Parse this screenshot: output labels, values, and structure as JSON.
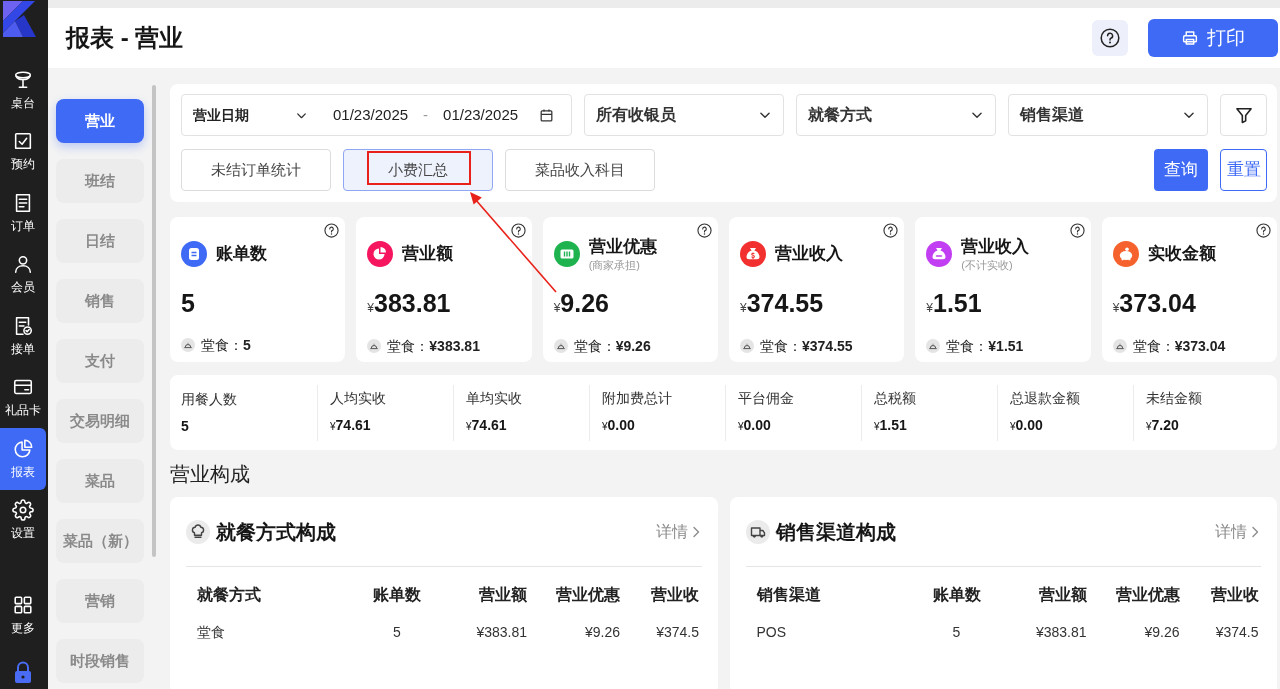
{
  "app_nav": [
    {
      "label": "桌台",
      "selected": false
    },
    {
      "label": "预约",
      "selected": false
    },
    {
      "label": "订单",
      "selected": false
    },
    {
      "label": "会员",
      "selected": false
    },
    {
      "label": "接单",
      "selected": false
    },
    {
      "label": "礼品卡",
      "selected": false
    },
    {
      "label": "报表",
      "selected": true
    },
    {
      "label": "设置",
      "selected": false
    },
    {
      "label": "更多",
      "selected": false
    }
  ],
  "header": {
    "title": "报表 - 营业",
    "print_button": "打印"
  },
  "report_nav": [
    {
      "label": "营业",
      "selected": true
    },
    {
      "label": "班结",
      "selected": false
    },
    {
      "label": "日结",
      "selected": false
    },
    {
      "label": "销售",
      "selected": false
    },
    {
      "label": "支付",
      "selected": false
    },
    {
      "label": "交易明细",
      "selected": false
    },
    {
      "label": "菜品",
      "selected": false
    },
    {
      "label": "菜品（新）",
      "selected": false
    },
    {
      "label": "营销",
      "selected": false
    },
    {
      "label": "时段销售",
      "selected": false
    }
  ],
  "filters": {
    "date_range": {
      "label": "营业日期",
      "start": "01/23/2025",
      "separator": "-",
      "end": "01/23/2025"
    },
    "selects": [
      {
        "value": "所有收银员"
      },
      {
        "value": "就餐方式"
      },
      {
        "value": "销售渠道"
      }
    ],
    "quick_filters": [
      {
        "label": "未结订单统计",
        "selected": false,
        "highlighted": false
      },
      {
        "label": "小费汇总",
        "selected": true,
        "highlighted": true
      },
      {
        "label": "菜品收入科目",
        "selected": false,
        "highlighted": false
      }
    ],
    "query_button": "查询",
    "reset_button": "重置"
  },
  "summary_cards": [
    {
      "title": "账单数",
      "value": "5",
      "detail_label": "堂食：",
      "detail_value": "5",
      "color": "#3e6af5"
    },
    {
      "title": "营业额",
      "currency": "¥",
      "value": "383.81",
      "detail_label": "堂食：",
      "detail_value": "¥383.81",
      "color": "#f5165f"
    },
    {
      "title": "营业优惠",
      "subtitle": "(商家承担)",
      "currency": "¥",
      "value": "9.26",
      "detail_label": "堂食：",
      "detail_value": "¥9.26",
      "color": "#1fb34f"
    },
    {
      "title": "营业收入",
      "currency": "¥",
      "value": "374.55",
      "detail_label": "堂食：",
      "detail_value": "¥374.55",
      "color": "#f23030"
    },
    {
      "title": "营业收入",
      "subtitle": "(不计实收)",
      "currency": "¥",
      "value": "1.51",
      "detail_label": "堂食：",
      "detail_value": "¥1.51",
      "color": "#c23ef2"
    },
    {
      "title": "实收金额",
      "currency": "¥",
      "value": "373.04",
      "detail_label": "堂食：",
      "detail_value": "¥373.04",
      "color": "#f5622d"
    }
  ],
  "stats": [
    {
      "label": "用餐人数",
      "value": "5"
    },
    {
      "label": "人均实收",
      "currency": "¥",
      "value": "74.61"
    },
    {
      "label": "单均实收",
      "currency": "¥",
      "value": "74.61"
    },
    {
      "label": "附加费总计",
      "currency": "¥",
      "value": "0.00"
    },
    {
      "label": "平台佣金",
      "currency": "¥",
      "value": "0.00"
    },
    {
      "label": "总税额",
      "currency": "¥",
      "value": "1.51"
    },
    {
      "label": "总退款金额",
      "currency": "¥",
      "value": "0.00"
    },
    {
      "label": "未结金额",
      "currency": "¥",
      "value": "7.20"
    }
  ],
  "section_title": "营业构成",
  "breakdowns": [
    {
      "title": "就餐方式构成",
      "details_link": "详情",
      "columns": [
        "就餐方式",
        "账单数",
        "营业额",
        "营业优惠",
        "营业收"
      ],
      "rows": [
        [
          "堂食",
          "5",
          "¥383.81",
          "¥9.26",
          "¥374.5"
        ]
      ]
    },
    {
      "title": "销售渠道构成",
      "details_link": "详情",
      "columns": [
        "销售渠道",
        "账单数",
        "营业额",
        "营业优惠",
        "营业收"
      ],
      "rows": [
        [
          "POS",
          "5",
          "¥383.81",
          "¥9.26",
          "¥374.5"
        ]
      ]
    }
  ]
}
